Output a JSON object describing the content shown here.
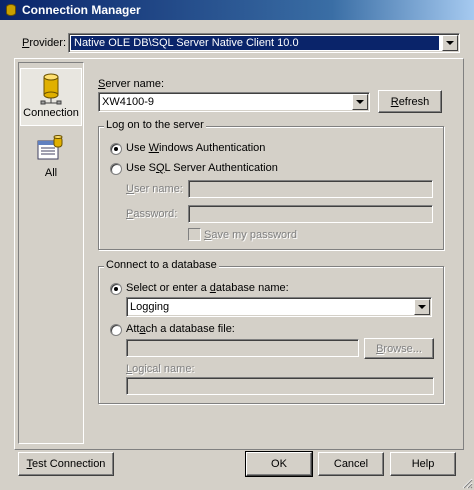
{
  "window": {
    "title": "Connection Manager"
  },
  "provider": {
    "label_prefix": "",
    "label_accel": "P",
    "label_rest": "rovider:",
    "value": "Native OLE DB\\SQL Server Native Client 10.0"
  },
  "sidebar": {
    "items": [
      {
        "label": "Connection",
        "icon": "database-cylinder-icon",
        "selected": true
      },
      {
        "label": "All",
        "icon": "properties-list-icon",
        "selected": false
      }
    ]
  },
  "server": {
    "label_prefix": "",
    "label_accel": "S",
    "label_rest": "erver name:",
    "value": "XW4100-9",
    "refresh_prefix": "",
    "refresh_accel": "R",
    "refresh_rest": "efresh"
  },
  "logon": {
    "group_title": "Log on to the server",
    "windows_auth_prefix": "Use ",
    "windows_auth_accel": "W",
    "windows_auth_rest": "indows Authentication",
    "sql_auth_prefix": "Use S",
    "sql_auth_accel": "Q",
    "sql_auth_rest": "L Server Authentication",
    "username_prefix": "",
    "username_accel": "U",
    "username_rest": "ser name:",
    "password_prefix": "",
    "password_accel": "P",
    "password_rest": "assword:",
    "save_password_prefix": "",
    "save_password_accel": "S",
    "save_password_rest": "ave my password"
  },
  "database": {
    "group_title": "Connect to a database",
    "select_prefix": "Select or enter a ",
    "select_accel": "d",
    "select_rest": "atabase name:",
    "db_value": "Logging",
    "attach_prefix": "Att",
    "attach_accel": "a",
    "attach_rest": "ch a database file:",
    "browse_prefix": "",
    "browse_accel": "B",
    "browse_rest": "rowse...",
    "logical_prefix": "",
    "logical_accel": "L",
    "logical_rest": "ogical name:"
  },
  "buttons": {
    "test_prefix": "",
    "test_accel": "T",
    "test_rest": "est Connection",
    "ok": "OK",
    "cancel": "Cancel",
    "help": "Help"
  },
  "colors": {
    "titlebar_start": "#0a246a",
    "titlebar_end": "#a6caf0",
    "face": "#d4d0c8",
    "selection": "#0a246a"
  }
}
